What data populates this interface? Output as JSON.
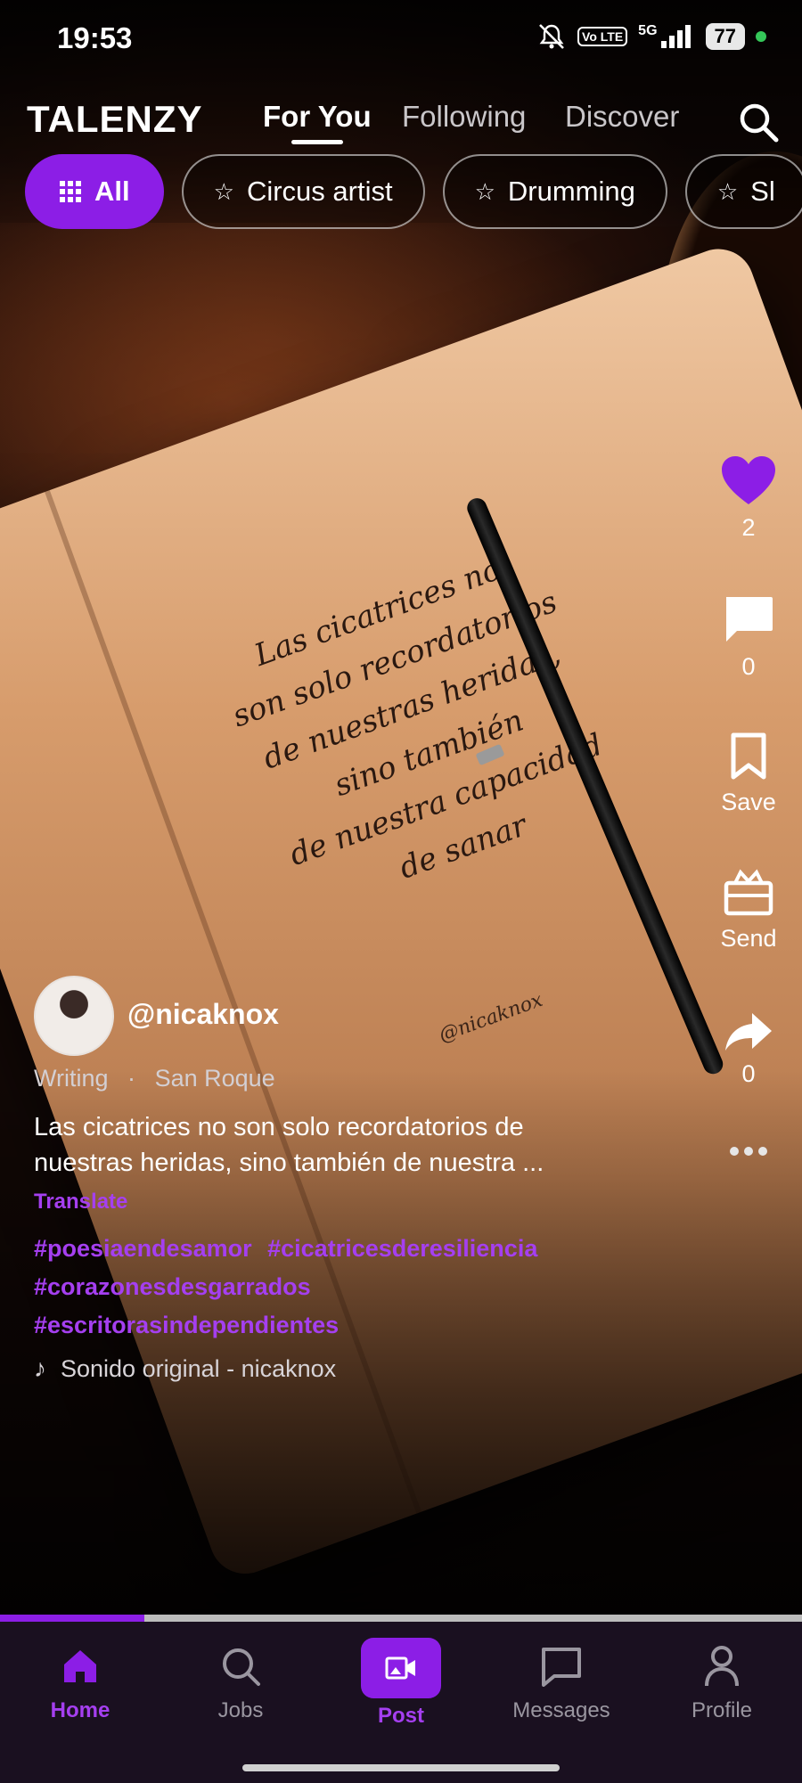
{
  "status_bar": {
    "time": "19:53",
    "icons": [
      "mute-icon",
      "volte-icon",
      "5g-signal-icon"
    ],
    "volte": "Vo LTE",
    "network": "5G",
    "battery": "77"
  },
  "header": {
    "brand": "TALENZY",
    "tabs": [
      {
        "label": "For You",
        "active": true
      },
      {
        "label": "Following",
        "active": false
      },
      {
        "label": "Discover",
        "active": false
      }
    ]
  },
  "chips": [
    {
      "label": "All",
      "icon": "grid-icon",
      "active": true
    },
    {
      "label": "Circus artist",
      "icon": "star-icon",
      "active": false
    },
    {
      "label": "Drumming",
      "icon": "star-icon",
      "active": false
    },
    {
      "label": "Sl",
      "icon": "star-icon",
      "active": false
    }
  ],
  "video": {
    "handwriting": [
      "Las cicatrices no",
      "son solo recordatorios",
      "de nuestras heridas,",
      "sino también",
      "de nuestra capacidad",
      "de sanar"
    ],
    "signature": "@nicaknox",
    "progress": 0.18
  },
  "actions": {
    "like_count": "2",
    "comment_count": "0",
    "save_label": "Save",
    "send_label": "Send",
    "share_count": "0"
  },
  "post": {
    "username": "@nicaknox",
    "category": "Writing",
    "separator": "·",
    "location": "San Roque",
    "caption": "Las cicatrices no son solo recordatorios de nuestras heridas, sino también de nuestra ...",
    "translate": "Translate",
    "hashtags": [
      "#poesiaendesamor",
      "#cicatricesderesiliencia",
      "#corazonesdesgarrados",
      "#escritorasindependientes"
    ],
    "sound": "Sonido original - nicaknox"
  },
  "bottom_nav": [
    {
      "label": "Home",
      "icon": "home-icon",
      "active": true
    },
    {
      "label": "Jobs",
      "icon": "search-icon",
      "active": false
    },
    {
      "label": "Post",
      "icon": "video-add-icon",
      "active": false
    },
    {
      "label": "Messages",
      "icon": "message-icon",
      "active": false
    },
    {
      "label": "Profile",
      "icon": "person-icon",
      "active": false
    }
  ],
  "colors": {
    "accent": "#8c1ee6",
    "accent_text": "#a53ff0",
    "nav_bg": "#1a1020"
  }
}
